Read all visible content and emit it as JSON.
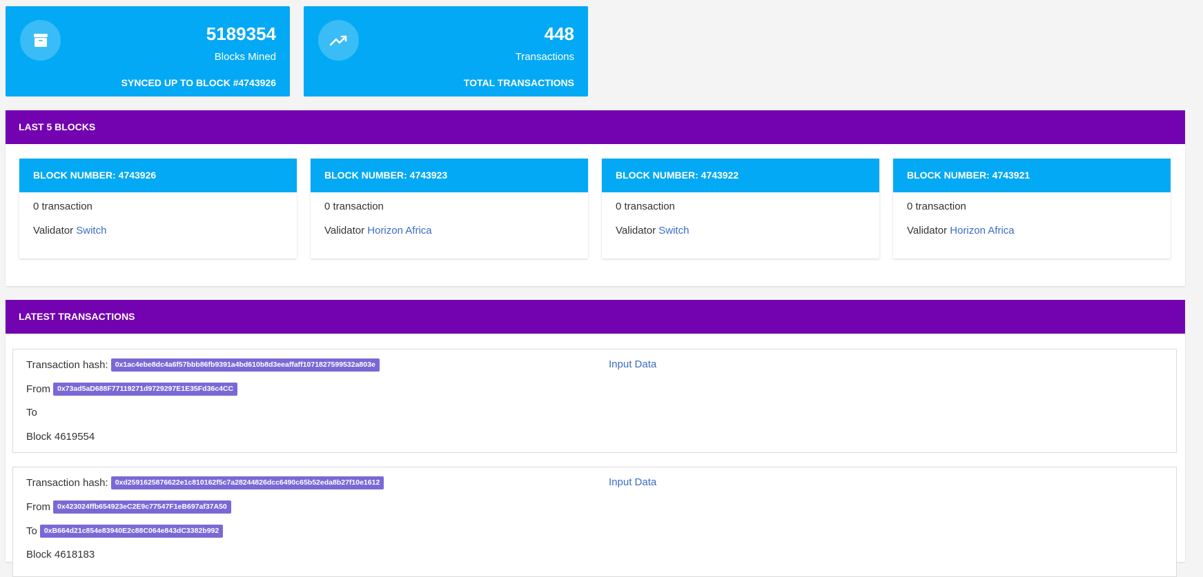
{
  "stats": [
    {
      "value": "5189354",
      "label": "Blocks Mined",
      "footer": "SYNCED UP TO BLOCK #4743926",
      "icon": "archive-icon"
    },
    {
      "value": "448",
      "label": "Transactions",
      "footer": "TOTAL TRANSACTIONS",
      "icon": "trending-up-icon"
    }
  ],
  "blocks_panel": {
    "title": "LAST 5 BLOCKS",
    "validator_label": "Validator",
    "blocks": [
      {
        "header": "BLOCK NUMBER: 4743926",
        "tx_count": "0 transaction",
        "validator": "Switch"
      },
      {
        "header": "BLOCK NUMBER: 4743923",
        "tx_count": "0 transaction",
        "validator": "Horizon Africa"
      },
      {
        "header": "BLOCK NUMBER: 4743922",
        "tx_count": "0 transaction",
        "validator": "Switch"
      },
      {
        "header": "BLOCK NUMBER: 4743921",
        "tx_count": "0 transaction",
        "validator": "Horizon Africa"
      }
    ]
  },
  "tx_panel": {
    "title": "LATEST TRANSACTIONS",
    "hash_label": "Transaction hash:",
    "from_label": "From",
    "to_label": "To",
    "input_label": "Input Data",
    "transactions": [
      {
        "hash": "0x1ac4ebe8dc4a6f57bbb86fb9391a4bd610b8d3eeaffaff1071827599532a803e",
        "from": "0x73ad5aD688F77119271d9729297E1E35Fd36c4CC",
        "to": "",
        "block": "Block 4619554"
      },
      {
        "hash": "0xd2591625876622e1c810162f5c7a28244826dcc6490c65b52eda8b27f10e1612",
        "from": "0x423024ffb654923eC2E9c77547F1eB697af37A50",
        "to": "0xB664d21c854e83940E2c88C064e843dC3382b992",
        "block": "Block 4618183"
      }
    ]
  },
  "colors": {
    "accent_blue": "#03a9f4",
    "header_purple": "#7303b0",
    "badge_purple": "#7b68d6",
    "link_blue": "#3a6cc4"
  }
}
